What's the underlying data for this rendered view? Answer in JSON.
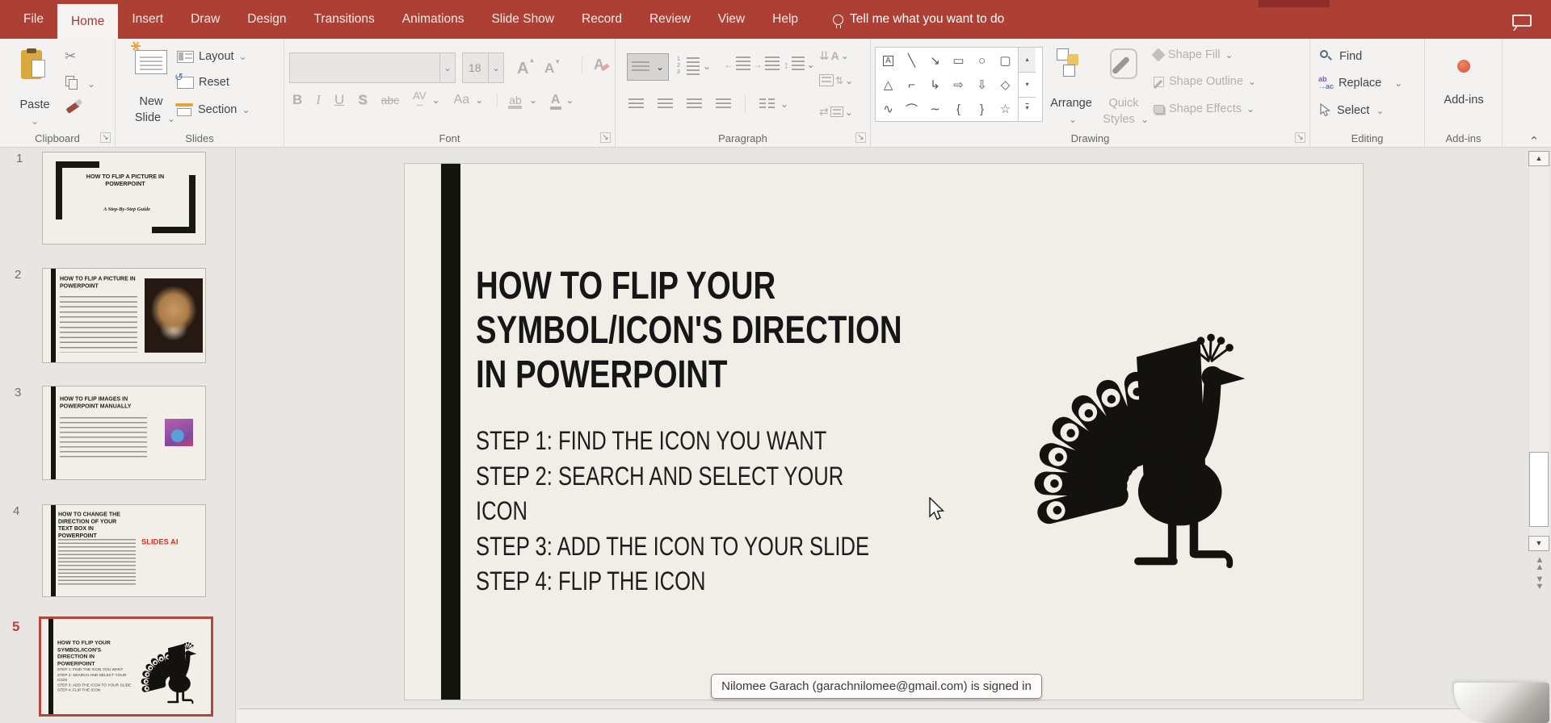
{
  "menu": {
    "tabs": [
      "File",
      "Home",
      "Insert",
      "Draw",
      "Design",
      "Transitions",
      "Animations",
      "Slide Show",
      "Record",
      "Review",
      "View",
      "Help"
    ],
    "active_tab": "Home",
    "tell_me": "Tell me what you want to do"
  },
  "ribbon": {
    "clipboard": {
      "paste": "Paste",
      "label": "Clipboard"
    },
    "slides": {
      "new_line1": "New",
      "new_line2": "Slide",
      "layout": "Layout",
      "reset": "Reset",
      "section": "Section",
      "label": "Slides"
    },
    "font": {
      "size": "18",
      "bold": "B",
      "italic": "I",
      "underline": "U",
      "shadow": "S",
      "strikethrough": "abc",
      "char_spacing": "AV",
      "change_case": "Aa",
      "highlight": "ab",
      "font_color": "A",
      "grow": "A",
      "shrink": "A",
      "clear": "A",
      "label": "Font"
    },
    "paragraph": {
      "label": "Paragraph"
    },
    "drawing": {
      "arrange": "Arrange",
      "quick_line1": "Quick",
      "quick_line2": "Styles",
      "shape_fill": "Shape Fill",
      "shape_outline": "Shape Outline",
      "shape_effects": "Shape Effects",
      "label": "Drawing"
    },
    "editing": {
      "find": "Find",
      "replace": "Replace",
      "select": "Select",
      "label": "Editing",
      "replace_top": "ab",
      "replace_bottom": "ac"
    },
    "addins": {
      "button": "Add-ins",
      "label": "Add-ins"
    }
  },
  "icons": {
    "chevron": "⌄",
    "dialog": "↘",
    "collapse": "⌃",
    "up": "▲",
    "down": "▼",
    "gup": "▴",
    "gdown": "▾",
    "scissors": "✂",
    "reset_arrow": "↺",
    "spacing_arrow": "↔",
    "updown": "↕",
    "textdir": "⇊",
    "aligntext": "⇅",
    "smartart": "⇄",
    "shapes": [
      "A",
      "╲",
      "↘",
      "▭",
      "○",
      "▢",
      "△",
      "⌐",
      "↳",
      "⇨",
      "⇩",
      "◇",
      "∿",
      "⌒",
      "∼",
      "{",
      "}",
      "☆"
    ],
    "numbering": "1 2 3"
  },
  "thumbnails": [
    {
      "number": "1",
      "title": "HOW TO FLIP A PICTURE IN POWERPOINT",
      "subtitle": "A Step-By-Step Guide"
    },
    {
      "number": "2",
      "title": "HOW TO FLIP A PICTURE IN POWERPOINT"
    },
    {
      "number": "3",
      "title": "HOW TO FLIP IMAGES IN POWERPOINT MANUALLY"
    },
    {
      "number": "4",
      "title": "HOW TO CHANGE THE DIRECTION OF YOUR TEXT BOX IN POWERPOINT",
      "accent_text": "SLIDES AI"
    },
    {
      "number": "5",
      "title": "HOW TO FLIP YOUR SYMBOL/ICON'S DIRECTION IN POWERPOINT",
      "step_lines": [
        "STEP 1: FIND THE ICON YOU WANT",
        "STEP 2: SEARCH AND SELECT YOUR",
        "ICON",
        "STEP 3: ADD THE ICON TO YOUR SLIDE",
        "STEP 4: FLIP THE ICON"
      ]
    }
  ],
  "slide": {
    "title_lines": [
      "HOW TO FLIP YOUR",
      "SYMBOL/ICON'S DIRECTION",
      "IN POWERPOINT"
    ],
    "step_lines": [
      "STEP 1: FIND THE ICON YOU WANT",
      "STEP 2: SEARCH AND SELECT YOUR",
      "ICON",
      "STEP 3: ADD THE ICON TO YOUR SLIDE",
      "STEP 4: FLIP THE ICON"
    ]
  },
  "tooltip": "Nilomee Garach (garachnilomee@gmail.com) is signed in",
  "colors": {
    "menubar": "#AD4035",
    "active_tab_text": "#A23B31",
    "selected_thumbnail_border": "#B5443B",
    "slide_background": "#F1EEE7",
    "slides_ai_red": "#E02B20",
    "addin_dot": "#E2694E"
  }
}
